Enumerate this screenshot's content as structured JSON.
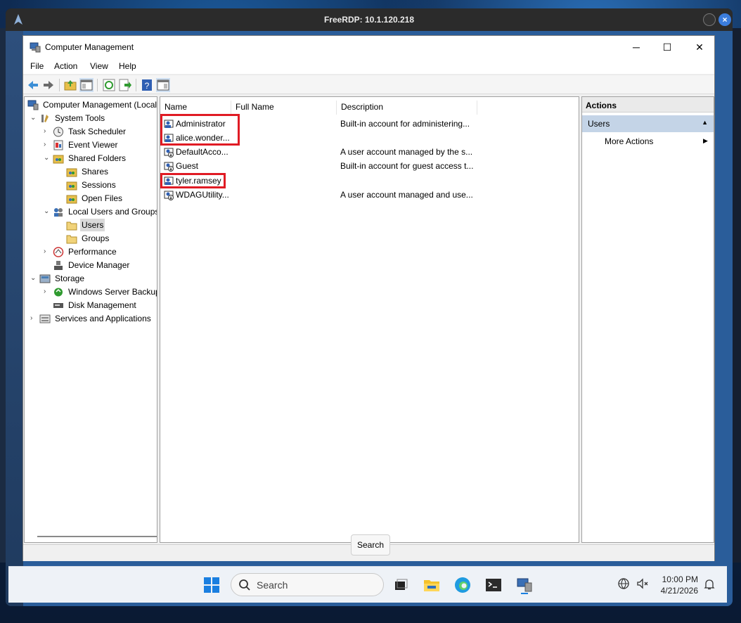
{
  "rdp": {
    "title": "FreeRDP: 10.1.120.218"
  },
  "window": {
    "title": "Computer Management",
    "controls": {
      "minimize": "─",
      "maximize": "☐",
      "close": "✕"
    }
  },
  "menu": [
    "File",
    "Action",
    "View",
    "Help"
  ],
  "tree": [
    {
      "label": "Computer Management (Local",
      "expander": ""
    },
    {
      "label": "System Tools",
      "expander": "⌄"
    },
    {
      "label": "Task Scheduler",
      "expander": "›"
    },
    {
      "label": "Event Viewer",
      "expander": "›"
    },
    {
      "label": "Shared Folders",
      "expander": "⌄"
    },
    {
      "label": "Shares",
      "expander": ""
    },
    {
      "label": "Sessions",
      "expander": ""
    },
    {
      "label": "Open Files",
      "expander": ""
    },
    {
      "label": "Local Users and Groups",
      "expander": "⌄"
    },
    {
      "label": "Users",
      "expander": ""
    },
    {
      "label": "Groups",
      "expander": ""
    },
    {
      "label": "Performance",
      "expander": "›"
    },
    {
      "label": "Device Manager",
      "expander": ""
    },
    {
      "label": "Storage",
      "expander": "⌄"
    },
    {
      "label": "Windows Server Backup",
      "expander": "›"
    },
    {
      "label": "Disk Management",
      "expander": ""
    },
    {
      "label": "Services and Applications",
      "expander": "›"
    }
  ],
  "list": {
    "columns": [
      "Name",
      "Full Name",
      "Description"
    ],
    "rows": [
      {
        "name": "Administrator",
        "full_name": "",
        "description": "Built-in account for administering..."
      },
      {
        "name": "alice.wonder...",
        "full_name": "",
        "description": ""
      },
      {
        "name": "DefaultAcco...",
        "full_name": "",
        "description": "A user account managed by the s..."
      },
      {
        "name": "Guest",
        "full_name": "",
        "description": "Built-in account for guest access t..."
      },
      {
        "name": "tyler.ramsey",
        "full_name": "",
        "description": ""
      },
      {
        "name": "WDAGUtility...",
        "full_name": "",
        "description": "A user account managed and use..."
      }
    ]
  },
  "actions": {
    "header": "Actions",
    "section": "Users",
    "section_arrow": "▲",
    "items": [
      {
        "label": "More Actions",
        "arrow": "▶"
      }
    ]
  },
  "tooltip": "Search",
  "taskbar": {
    "search_label": "Search",
    "time": "10:00 PM",
    "date": "4/21/2026"
  },
  "colors": {
    "highlight_box": "#e01b24",
    "selection": "#c4d4e7"
  }
}
